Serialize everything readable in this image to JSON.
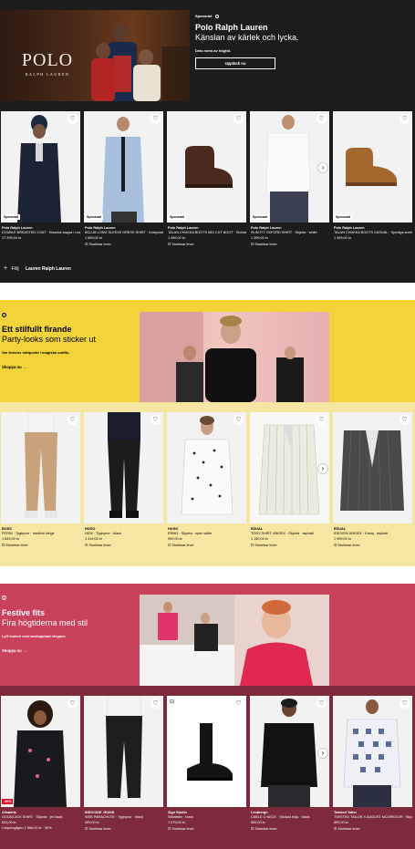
{
  "sponsored": {
    "label": "Sponsrad",
    "brand": "Polo Ralph Lauren",
    "headline": "Känslan av kärlek och lycka.",
    "subtitle": "Dela mera av högtid.",
    "cta": "Upptäck nu",
    "logo_main": "POLO",
    "logo_sub": "RALPH LAUREN",
    "follow_label": "Följ",
    "follow_brand": "Lauren Ralph Lauren",
    "products": [
      {
        "tag": "Sponsrad",
        "brand": "Polo Ralph Lauren",
        "name": "DOUBLE BREASTED COAT · Klassisk kappa / rock",
        "price": "17 299,00 kr",
        "note": ""
      },
      {
        "tag": "Sponsrad",
        "brand": "Polo Ralph Lauren",
        "name": "BCLUB LONG SLEEVE DRESS SHIRT · Kostymskjorta",
        "price": "1 899,00 kr",
        "note": "Storlekar lever"
      },
      {
        "tag": "Sponsrad",
        "brand": "Polo Ralph Lauren",
        "name": "TALAN CHUKKA BOOTS MID CUT BOOT · Snörskor",
        "price": "1 499,00 kr",
        "note": "Storlekar lever"
      },
      {
        "tag": "Sponsrad",
        "brand": "Polo Ralph Lauren",
        "name": "SLIM FIT OXFORD SHIRT · Skjorta · white",
        "price": "1 399,00 kr",
        "note": "Storlekar lever"
      },
      {
        "tag": "Sponsrad",
        "brand": "Polo Ralph Lauren",
        "name": "TALAN CHUKKA BOOTS CASUAL · Sportiga snörskor",
        "price": "1 499,00 kr",
        "note": ""
      }
    ]
  },
  "party": {
    "title": "Ett stilfullt firande",
    "subtitle": "Party-looks som sticker ut",
    "desc": "Var festens mittpunkt i magiska outfits.",
    "cta": "Shoppa nu →",
    "products": [
      {
        "brand": "BOSS",
        "name": "PERIN · Tygbyxor · medium beige",
        "price": "1 849,00 kr",
        "note": "Storlekar lever"
      },
      {
        "brand": "HUGO",
        "name": "NICK · Tygbyxor · black",
        "price": "1 419,00 kr",
        "note": "Storlekar lever"
      },
      {
        "brand": "HUGO",
        "name": "ERMO · Skjorta · open white",
        "price": "999,00 kr",
        "note": "Storlekar lever"
      },
      {
        "brand": "EDUAL",
        "name": "TONY SHIRT UNISEX · Skjorta · asphalt",
        "price": "1 150,00 kr",
        "note": "Storlekar lever"
      },
      {
        "brand": "EDUAL",
        "name": "IDESIGN UNISEX · Kavaj · asphalt",
        "price": "1 999,00 kr",
        "note": "Storlekar lever"
      }
    ]
  },
  "festive": {
    "title": "Festive fits",
    "subtitle": "Fira högtiderna med stil",
    "desc": "Lyft looken med avslappnad elegans.",
    "cta": "Shoppa nu →",
    "products": [
      {
        "brand": "Allsaints",
        "name": "GOODLUCK SHIRT · Skjorta · jet black",
        "price": "823,00 kr",
        "note": "Ursprungligen 1 566,00 kr · 50%",
        "badge": "-50%"
      },
      {
        "brand": "INDICODE JEANS",
        "name": "WEB PARACHUTE · Tygbyxor · black",
        "price": "499,00 kr",
        "note": "Storlekar lever",
        "badge": ""
      },
      {
        "brand": "Zign Studio",
        "name": "Stövletter · black",
        "price": "1 079,00 kr",
        "note": "Storlekar lever",
        "badge": ""
      },
      {
        "brand": "Lindbergh",
        "name": "CABLE O NECK · Stickad tröja · black",
        "price": "899,00 kr",
        "note": "Storlekar lever",
        "badge": ""
      },
      {
        "brand": "Twisted Tailor",
        "name": "TWISTED TAILOR X AUGUST MCGREGOR · Skjorta",
        "price": "899,00 kr",
        "note": "Storlekar lever",
        "badge": ""
      }
    ]
  },
  "colors": {
    "black_band": "#1c1c1c",
    "yellow": "#f2d33a",
    "pale_yellow": "#f5e7a1",
    "pink": "#c9415b",
    "maroon": "#7d2a3a"
  }
}
